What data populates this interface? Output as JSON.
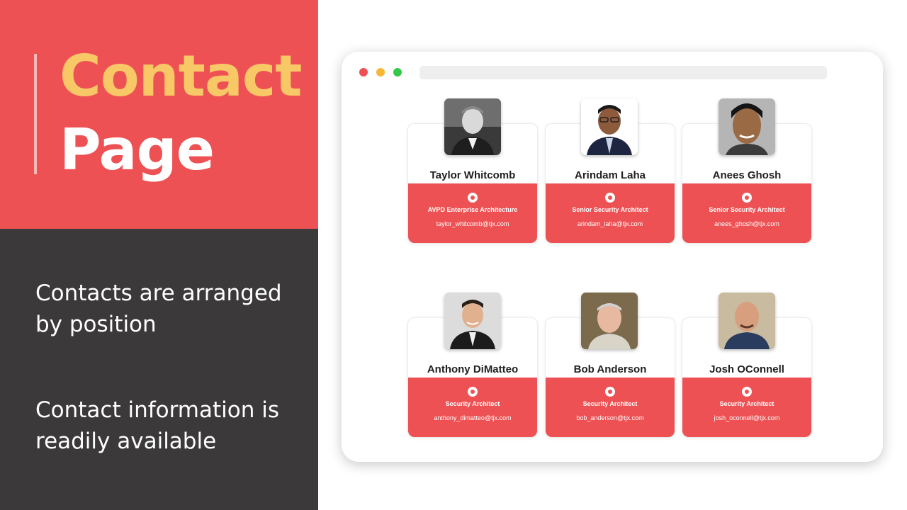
{
  "slide": {
    "title_line1": "Contact",
    "title_line2": "Page",
    "bullets": [
      "Contacts are arranged by position",
      "Contact information is readily available"
    ]
  },
  "colors": {
    "accent_red": "#ee5153",
    "title_yellow": "#f8c867",
    "dark_panel": "#3b393a"
  },
  "browser": {
    "window_controls": [
      "close-dot-icon",
      "minimize-dot-icon",
      "maximize-dot-icon"
    ]
  },
  "contacts": [
    {
      "name": "Taylor Whitcomb",
      "title": "AVPD Enterprise Architecture",
      "email": "taylor_whitcomb@tjx.com",
      "icon": "badge-icon"
    },
    {
      "name": "Arindam Laha",
      "title": "Senior Security Architect",
      "email": "arindam_laha@tjx.com",
      "icon": "badge-icon"
    },
    {
      "name": "Anees Ghosh",
      "title": "Senior Security Architect",
      "email": "anees_ghosh@tjx.com",
      "icon": "badge-icon"
    },
    {
      "name": "Anthony DiMatteo",
      "title": "Security Architect",
      "email": "anthony_dimatteo@tjx.com",
      "icon": "badge-icon"
    },
    {
      "name": "Bob Anderson",
      "title": "Security Architect",
      "email": "bob_anderson@tjx.com",
      "icon": "badge-icon"
    },
    {
      "name": "Josh OConnell",
      "title": "Security Architect",
      "email": "josh_oconnell@tjx.com",
      "icon": "badge-icon"
    }
  ]
}
